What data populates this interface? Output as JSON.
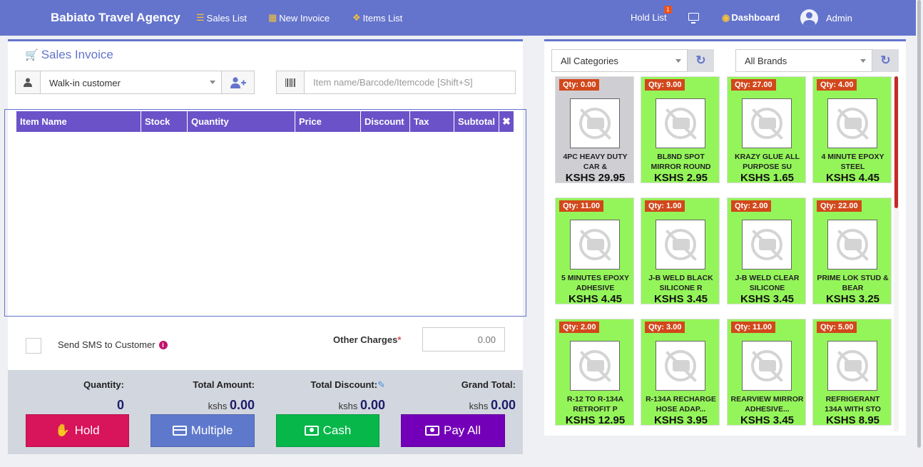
{
  "navbar": {
    "brand": "Babiato Travel Agency",
    "links": [
      {
        "icon": "list-icon",
        "label": "Sales List"
      },
      {
        "icon": "calculator-icon",
        "label": "New Invoice"
      },
      {
        "icon": "cubes-icon",
        "label": "Items List"
      }
    ],
    "hold_list_label": "Hold List",
    "hold_count": "1",
    "dashboard_label": "Dashboard",
    "user_name": "Admin"
  },
  "invoice": {
    "title": "Sales Invoice",
    "customer_value": "Walk-in customer",
    "item_search_placeholder": "Item name/Barcode/Itemcode [Shift+S]",
    "table_headers": [
      "Item Name",
      "Stock",
      "Quantity",
      "Price",
      "Discount",
      "Tax",
      "Subtotal"
    ],
    "sms_label": "Send SMS to Customer",
    "other_charges_label": "Other Charges",
    "other_charges_required": "*",
    "other_charges_placeholder": "0.00"
  },
  "totals": {
    "quantity_label": "Quantity:",
    "quantity_value": "0",
    "total_amount_label": "Total Amount:",
    "total_amount_value": "0.00",
    "total_discount_label": "Total Discount:",
    "total_discount_value": "0.00",
    "grand_total_label": "Grand Total:",
    "grand_total_value": "0.00",
    "currency_unit": "kshs"
  },
  "actions": {
    "hold": "Hold",
    "multiple": "Multiple",
    "cash": "Cash",
    "pay_all": "Pay All"
  },
  "filters": {
    "category_value": "All Categories",
    "brand_value": "All Brands"
  },
  "products": [
    {
      "qty": "Qty: 0.00",
      "name": "4PC HEAVY DUTY CAR &",
      "price": "KSHS 29.95",
      "in_stock": false
    },
    {
      "qty": "Qty: 9.00",
      "name": "BL8ND SPOT MIRROR ROUND",
      "price": "KSHS 2.95",
      "in_stock": true
    },
    {
      "qty": "Qty: 27.00",
      "name": "KRAZY GLUE ALL PURPOSE SU",
      "price": "KSHS 1.65",
      "in_stock": true
    },
    {
      "qty": "Qty: 4.00",
      "name": "4 MINUTE EPOXY STEEL",
      "price": "KSHS 4.45",
      "in_stock": true
    },
    {
      "qty": "Qty: 11.00",
      "name": "5 MINUTES EPOXY ADHESIVE",
      "price": "KSHS 4.45",
      "in_stock": true
    },
    {
      "qty": "Qty: 1.00",
      "name": "J-B WELD BLACK SILICONE R",
      "price": "KSHS 3.45",
      "in_stock": true
    },
    {
      "qty": "Qty: 2.00",
      "name": "J-B WELD CLEAR SILICONE",
      "price": "KSHS 3.45",
      "in_stock": true
    },
    {
      "qty": "Qty: 22.00",
      "name": "PRIME LOK STUD & BEAR",
      "price": "KSHS 3.25",
      "in_stock": true
    },
    {
      "qty": "Qty: 2.00",
      "name": "R-12 TO R-134A RETROFIT P",
      "price": "KSHS 12.95",
      "in_stock": true
    },
    {
      "qty": "Qty: 3.00",
      "name": "R-134A RECHARGE HOSE ADAP...",
      "price": "KSHS 3.95",
      "in_stock": true
    },
    {
      "qty": "Qty: 11.00",
      "name": "REARVIEW MIRROR ADHESIVE...",
      "price": "KSHS 3.45",
      "in_stock": true
    },
    {
      "qty": "Qty: 5.00",
      "name": "REFRIGERANT 134A WITH STO",
      "price": "KSHS 8.95",
      "in_stock": true
    }
  ],
  "colors": {
    "navbar": "#6474cc",
    "table_header": "#6b52c8",
    "in_stock": "#94f55a",
    "out_of_stock": "#cfcfd3",
    "qty_badge": "#d2481b",
    "hold": "#d8145a",
    "multiple": "#5e79cc",
    "cash": "#07b74a",
    "pay_all": "#7300b8"
  }
}
